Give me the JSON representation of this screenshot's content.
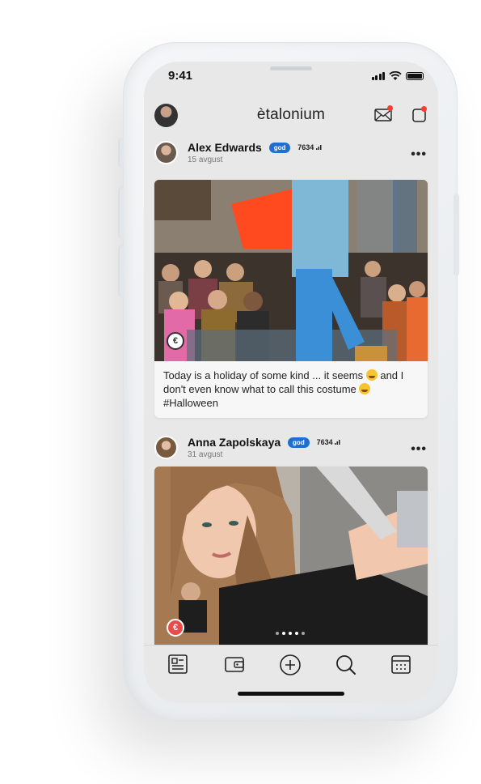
{
  "status": {
    "time": "9:41"
  },
  "header": {
    "app_title": "ètalonium"
  },
  "posts": [
    {
      "author": "Alex Edwards",
      "badge": "god",
      "score": "7634",
      "date": "15 avgust",
      "caption": [
        "Today is a holiday of some kind ... it seems ",
        " and I don't even know what to call this costume ",
        " #Halloween"
      ]
    },
    {
      "author": "Anna Zapolskaya",
      "badge": "god",
      "score": "7634",
      "date": "31 avgust"
    }
  ],
  "colors": {
    "accent": "#1f6fd1",
    "notification": "#ff3b30",
    "background": "#e8e8e8"
  },
  "icons": {
    "header": [
      "avatar",
      "mail-icon",
      "notification-icon"
    ],
    "tabbar": [
      "feed-icon",
      "wallet-icon",
      "add-icon",
      "search-icon",
      "calendar-icon"
    ]
  }
}
